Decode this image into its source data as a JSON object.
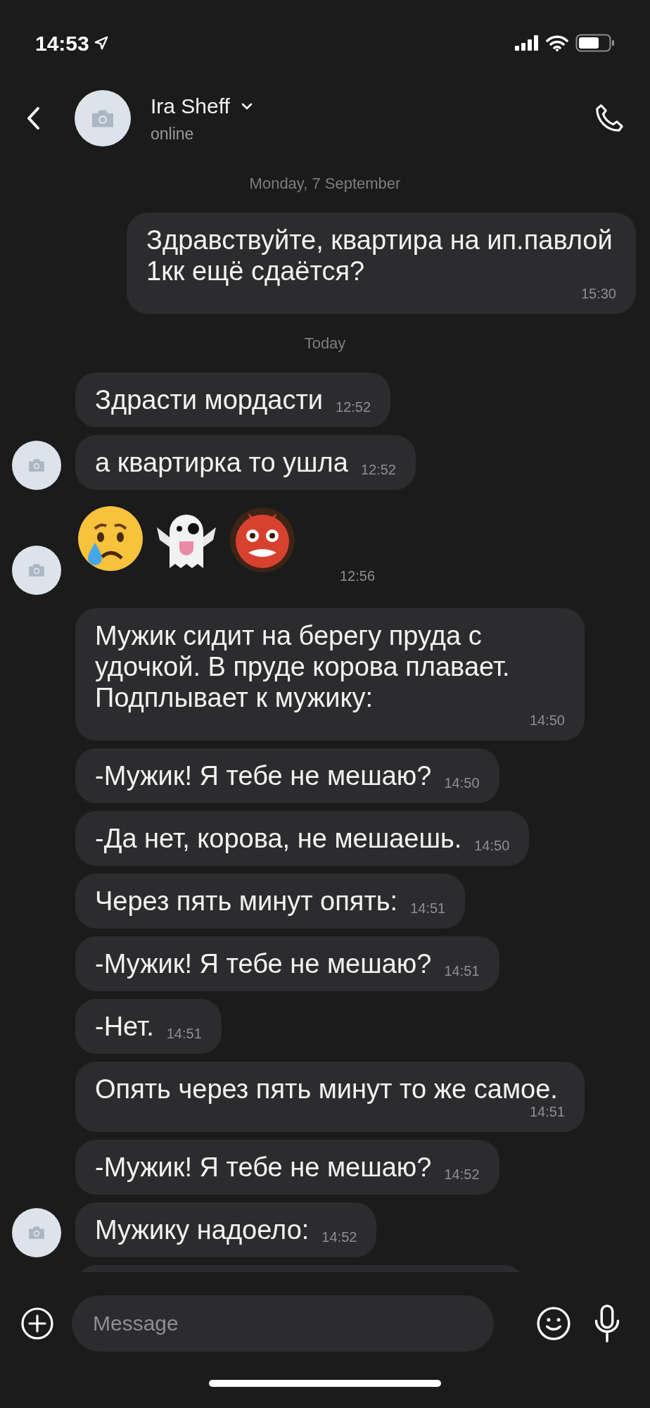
{
  "status_bar": {
    "time": "14:53"
  },
  "header": {
    "name": "Ira Sheff",
    "status": "online"
  },
  "messages": [
    {
      "kind": "date",
      "text": "Monday, 7 September"
    },
    {
      "kind": "text",
      "outgoing": true,
      "text": "Здравствуйте, квартира на ип.павлой 1кк ещё сдаётся?",
      "time": "15:30"
    },
    {
      "kind": "date",
      "text": "Today"
    },
    {
      "kind": "text",
      "outgoing": false,
      "text": "Здрасти мордасти",
      "time": "12:52",
      "avatar": false
    },
    {
      "kind": "text",
      "outgoing": false,
      "text": "а квартирка то ушла",
      "time": "12:52",
      "avatar": true
    },
    {
      "kind": "emoji",
      "outgoing": false,
      "emoji": [
        {
          "kind": "crying"
        },
        {
          "kind": "ghost"
        },
        {
          "kind": "ogre"
        }
      ],
      "time": "12:56",
      "avatar": true
    },
    {
      "kind": "text",
      "outgoing": false,
      "text": "Мужик сидит на берегу пруда с удочкой. В пруде корова плавает. Подплывает к мужику:",
      "time": "14:50",
      "avatar": false
    },
    {
      "kind": "text",
      "outgoing": false,
      "text": "-Мужик! Я тебе не мешаю?",
      "time": "14:50",
      "avatar": false
    },
    {
      "kind": "text",
      "outgoing": false,
      "text": "-Да нет, корова, не мешаешь.",
      "time": "14:50",
      "avatar": false
    },
    {
      "kind": "text",
      "outgoing": false,
      "text": "Через пять минут опять:",
      "time": "14:51",
      "avatar": false
    },
    {
      "kind": "text",
      "outgoing": false,
      "text": "-Мужик! Я тебе не мешаю?",
      "time": "14:51",
      "avatar": false
    },
    {
      "kind": "text",
      "outgoing": false,
      "text": "-Нет.",
      "time": "14:51",
      "avatar": false
    },
    {
      "kind": "text",
      "outgoing": false,
      "text": "Опять через пять минут то же самое.",
      "time": "14:51",
      "avatar": false
    },
    {
      "kind": "text",
      "outgoing": false,
      "text": "-Мужик! Я тебе не мешаю?",
      "time": "14:52",
      "avatar": false
    },
    {
      "kind": "text",
      "outgoing": false,
      "text": "Мужику надоело:",
      "time": "14:52",
      "avatar": true
    },
    {
      "kind": "partial",
      "outgoing": false
    }
  ],
  "composer": {
    "placeholder": "Message"
  }
}
